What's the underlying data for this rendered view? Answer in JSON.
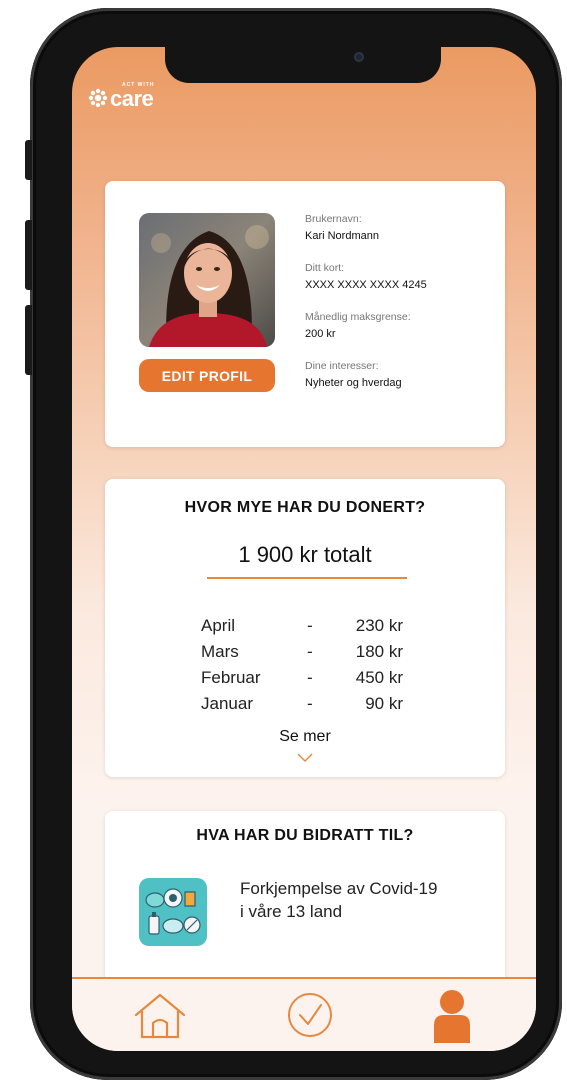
{
  "header": {
    "logo_small": "ACT WITH",
    "logo_big": "care"
  },
  "profile": {
    "edit_button": "EDIT PROFIL",
    "fields": [
      {
        "label": "Brukernavn:",
        "value": "Kari Nordmann"
      },
      {
        "label": "Ditt kort:",
        "value": "XXXX XXXX XXXX 4245"
      },
      {
        "label": "Månedlig maksgrense:",
        "value": "200 kr"
      },
      {
        "label": "Dine interesser:",
        "value": "Nyheter og hverdag"
      }
    ]
  },
  "donations": {
    "title": "HVOR MYE HAR DU DONERT?",
    "total": "1 900 kr totalt",
    "months": [
      {
        "name": "April",
        "dash": "-",
        "amount": "230 kr"
      },
      {
        "name": "Mars",
        "dash": "-",
        "amount": "180 kr"
      },
      {
        "name": "Februar",
        "dash": "-",
        "amount": "450 kr"
      },
      {
        "name": "Januar",
        "dash": "-",
        "amount": "90 kr"
      }
    ],
    "see_more": "Se mer"
  },
  "contributions": {
    "title": "HVA HAR DU BIDRATT TIL?",
    "items": [
      {
        "icon": "covid-supplies-icon",
        "text_line1": "Forkjempelse av Covid-19",
        "text_line2": "i våre 13 land"
      }
    ]
  },
  "nav": {
    "items": [
      {
        "icon": "home-icon"
      },
      {
        "icon": "check-circle-icon"
      },
      {
        "icon": "profile-icon"
      }
    ]
  },
  "colors": {
    "accent": "#e6762f",
    "header_gradient_top": "#eb9a62",
    "background_light": "#fdf3ee",
    "icon_teal": "#4fc0c3"
  }
}
